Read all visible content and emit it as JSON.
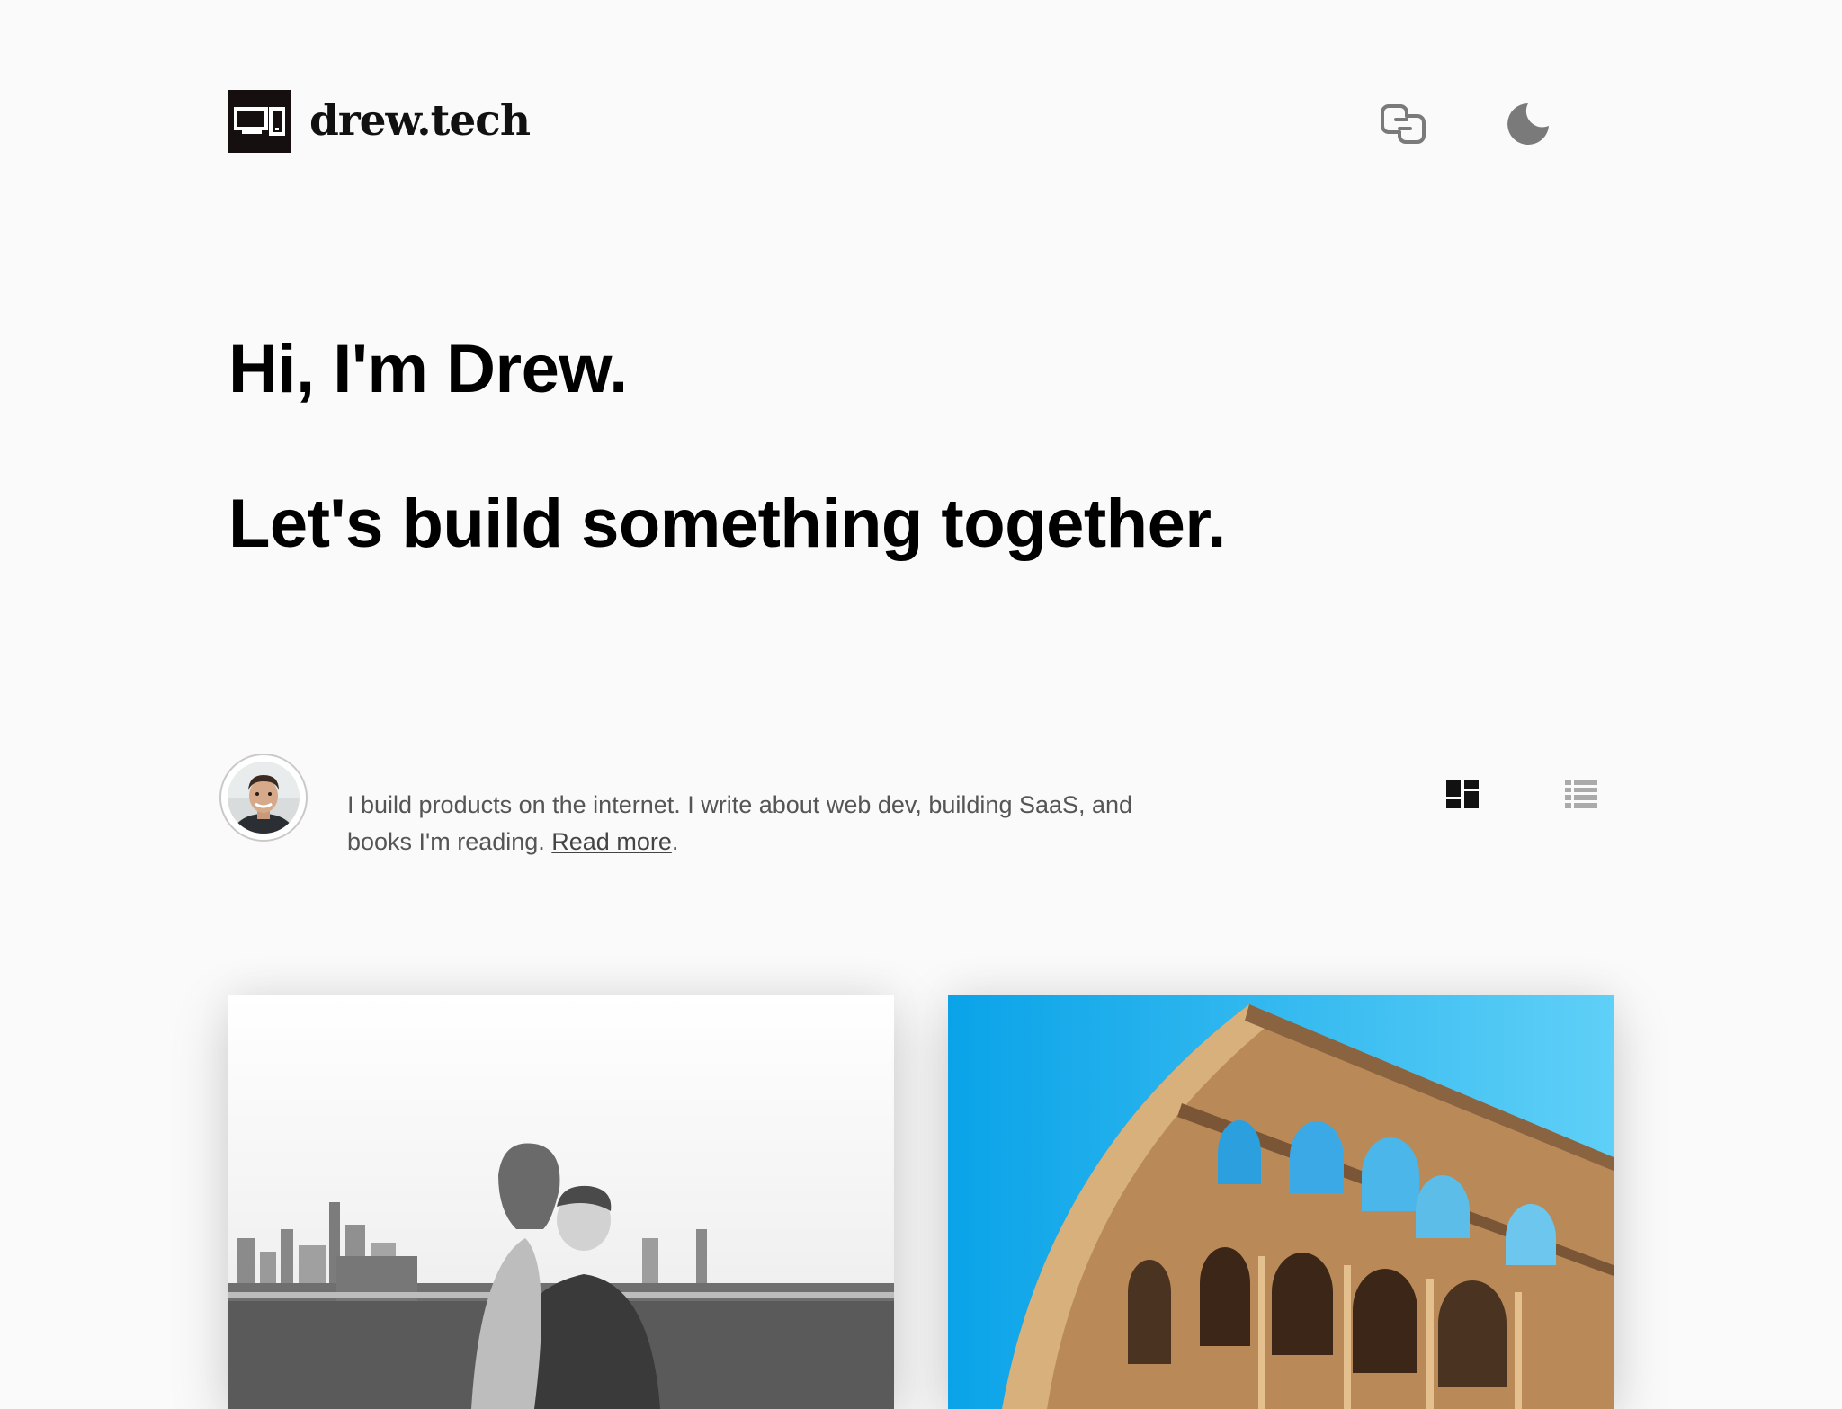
{
  "site": {
    "logo_text": "drew.tech"
  },
  "header": {
    "icons": [
      "chat-links-icon",
      "moon-icon"
    ]
  },
  "hero": {
    "line1": "Hi, I'm Drew.",
    "line2": "Let's build something together."
  },
  "intro": {
    "bio_text": "I build products on the internet. I write about web dev, building SaaS, and books I'm reading. ",
    "read_more": "Read more",
    "period": "."
  },
  "view_toggle": {
    "grid": "grid-view-icon",
    "list": "list-view-icon"
  },
  "colors": {
    "background": "#fafafa",
    "logo_bg": "#150f0f",
    "text": "#000000",
    "muted_text": "#555555",
    "icon_gray": "#7a7a7a",
    "sky_blue": "#29b6f0"
  }
}
